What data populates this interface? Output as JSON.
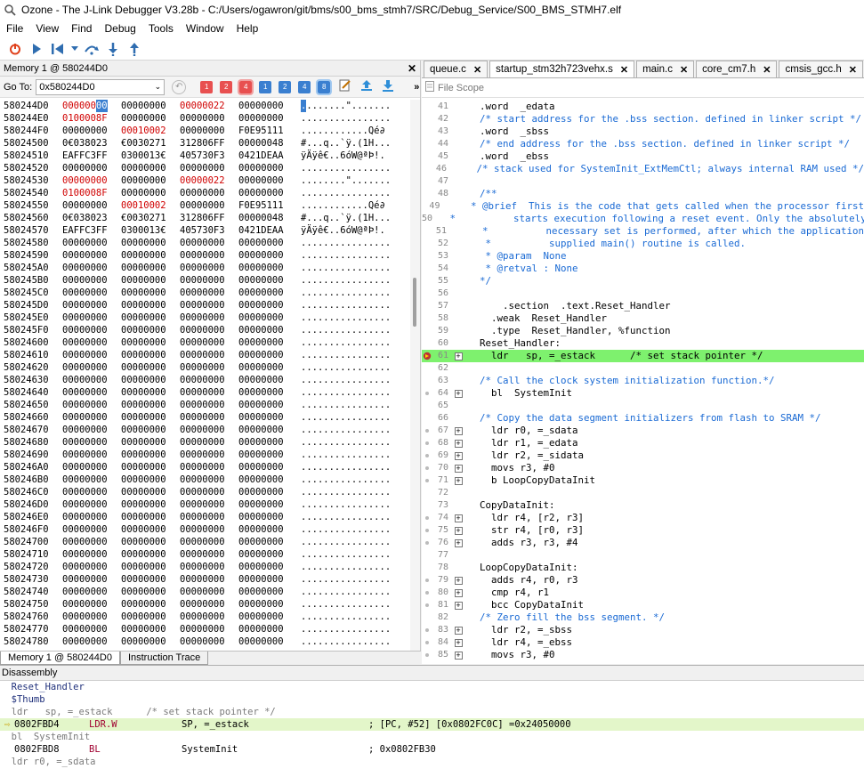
{
  "window": {
    "title": "Ozone - The J-Link Debugger V3.28b - C:/Users/ogawron/git/bms/s00_bms_stmh7/SRC/Debug_Service/S00_BMS_STMH7.elf"
  },
  "menu": [
    "File",
    "View",
    "Find",
    "Debug",
    "Tools",
    "Window",
    "Help"
  ],
  "toolbar_icons": [
    "power-icon",
    "play-icon",
    "reset-icon",
    "dropdown-icon",
    "step-over-icon",
    "step-into-icon",
    "step-out-icon"
  ],
  "memory": {
    "title": "Memory 1 @ 580244D0",
    "goto_label": "Go To:",
    "goto_value": "0x580244D0",
    "buttons": [
      "1",
      "2",
      "4",
      "1",
      "2",
      "4",
      "8"
    ],
    "rows": [
      {
        "addr": "580244D0",
        "w": [
          "00000000",
          "00000000",
          "00000022",
          "00000000"
        ],
        "red": [
          0,
          2
        ],
        "ascii": "........\"......."
      },
      {
        "addr": "580244E0",
        "w": [
          "0100008F",
          "00000000",
          "00000000",
          "00000000"
        ],
        "red": [
          0
        ],
        "ascii": "................"
      },
      {
        "addr": "580244F0",
        "w": [
          "00000000",
          "00010002",
          "00000000",
          "F0E95111"
        ],
        "red": [
          1
        ],
        "ascii": "............Qé∂"
      },
      {
        "addr": "58024500",
        "w": [
          "0€038023",
          "€0030271",
          "312806FF",
          "00000048"
        ],
        "red": [],
        "ascii": "#...q..`ÿ.(1H..."
      },
      {
        "addr": "58024510",
        "w": [
          "EAFFC3FF",
          "0300013€",
          "405730F3",
          "0421DEAA"
        ],
        "red": [],
        "ascii": "ÿÄÿê€..6óW@ªÞ!."
      },
      {
        "addr": "58024520",
        "w": [
          "00000000",
          "00000000",
          "00000000",
          "00000000"
        ],
        "red": [],
        "ascii": "................"
      },
      {
        "addr": "58024530",
        "w": [
          "00000000",
          "00000000",
          "00000022",
          "00000000"
        ],
        "red": [
          0,
          2
        ],
        "ascii": "........\"......."
      },
      {
        "addr": "58024540",
        "w": [
          "0100008F",
          "00000000",
          "00000000",
          "00000000"
        ],
        "red": [
          0
        ],
        "ascii": "................"
      },
      {
        "addr": "58024550",
        "w": [
          "00000000",
          "00010002",
          "00000000",
          "F0E95111"
        ],
        "red": [
          1
        ],
        "ascii": "............Qé∂"
      },
      {
        "addr": "58024560",
        "w": [
          "0€038023",
          "€0030271",
          "312806FF",
          "00000048"
        ],
        "red": [],
        "ascii": "#...q..`ÿ.(1H..."
      },
      {
        "addr": "58024570",
        "w": [
          "EAFFC3FF",
          "0300013€",
          "405730F3",
          "0421DEAA"
        ],
        "red": [],
        "ascii": "ÿÄÿê€..6óW@ªÞ!."
      },
      {
        "addr": "58024580",
        "w": [
          "00000000",
          "00000000",
          "00000000",
          "00000000"
        ],
        "red": [],
        "ascii": "................"
      },
      {
        "addr": "58024590",
        "w": [
          "00000000",
          "00000000",
          "00000000",
          "00000000"
        ],
        "red": [],
        "ascii": "................"
      },
      {
        "addr": "580245A0",
        "w": [
          "00000000",
          "00000000",
          "00000000",
          "00000000"
        ],
        "red": [],
        "ascii": "................"
      },
      {
        "addr": "580245B0",
        "w": [
          "00000000",
          "00000000",
          "00000000",
          "00000000"
        ],
        "red": [],
        "ascii": "................"
      },
      {
        "addr": "580245C0",
        "w": [
          "00000000",
          "00000000",
          "00000000",
          "00000000"
        ],
        "red": [],
        "ascii": "................"
      },
      {
        "addr": "580245D0",
        "w": [
          "00000000",
          "00000000",
          "00000000",
          "00000000"
        ],
        "red": [],
        "ascii": "................"
      },
      {
        "addr": "580245E0",
        "w": [
          "00000000",
          "00000000",
          "00000000",
          "00000000"
        ],
        "red": [],
        "ascii": "................"
      },
      {
        "addr": "580245F0",
        "w": [
          "00000000",
          "00000000",
          "00000000",
          "00000000"
        ],
        "red": [],
        "ascii": "................"
      },
      {
        "addr": "58024600",
        "w": [
          "00000000",
          "00000000",
          "00000000",
          "00000000"
        ],
        "red": [],
        "ascii": "................"
      },
      {
        "addr": "58024610",
        "w": [
          "00000000",
          "00000000",
          "00000000",
          "00000000"
        ],
        "red": [],
        "ascii": "................"
      },
      {
        "addr": "58024620",
        "w": [
          "00000000",
          "00000000",
          "00000000",
          "00000000"
        ],
        "red": [],
        "ascii": "................"
      },
      {
        "addr": "58024630",
        "w": [
          "00000000",
          "00000000",
          "00000000",
          "00000000"
        ],
        "red": [],
        "ascii": "................"
      },
      {
        "addr": "58024640",
        "w": [
          "00000000",
          "00000000",
          "00000000",
          "00000000"
        ],
        "red": [],
        "ascii": "................"
      },
      {
        "addr": "58024650",
        "w": [
          "00000000",
          "00000000",
          "00000000",
          "00000000"
        ],
        "red": [],
        "ascii": "................"
      },
      {
        "addr": "58024660",
        "w": [
          "00000000",
          "00000000",
          "00000000",
          "00000000"
        ],
        "red": [],
        "ascii": "................"
      },
      {
        "addr": "58024670",
        "w": [
          "00000000",
          "00000000",
          "00000000",
          "00000000"
        ],
        "red": [],
        "ascii": "................"
      },
      {
        "addr": "58024680",
        "w": [
          "00000000",
          "00000000",
          "00000000",
          "00000000"
        ],
        "red": [],
        "ascii": "................"
      },
      {
        "addr": "58024690",
        "w": [
          "00000000",
          "00000000",
          "00000000",
          "00000000"
        ],
        "red": [],
        "ascii": "................"
      },
      {
        "addr": "580246A0",
        "w": [
          "00000000",
          "00000000",
          "00000000",
          "00000000"
        ],
        "red": [],
        "ascii": "................"
      },
      {
        "addr": "580246B0",
        "w": [
          "00000000",
          "00000000",
          "00000000",
          "00000000"
        ],
        "red": [],
        "ascii": "................"
      },
      {
        "addr": "580246C0",
        "w": [
          "00000000",
          "00000000",
          "00000000",
          "00000000"
        ],
        "red": [],
        "ascii": "................"
      },
      {
        "addr": "580246D0",
        "w": [
          "00000000",
          "00000000",
          "00000000",
          "00000000"
        ],
        "red": [],
        "ascii": "................"
      },
      {
        "addr": "580246E0",
        "w": [
          "00000000",
          "00000000",
          "00000000",
          "00000000"
        ],
        "red": [],
        "ascii": "................"
      },
      {
        "addr": "580246F0",
        "w": [
          "00000000",
          "00000000",
          "00000000",
          "00000000"
        ],
        "red": [],
        "ascii": "................"
      },
      {
        "addr": "58024700",
        "w": [
          "00000000",
          "00000000",
          "00000000",
          "00000000"
        ],
        "red": [],
        "ascii": "................"
      },
      {
        "addr": "58024710",
        "w": [
          "00000000",
          "00000000",
          "00000000",
          "00000000"
        ],
        "red": [],
        "ascii": "................"
      },
      {
        "addr": "58024720",
        "w": [
          "00000000",
          "00000000",
          "00000000",
          "00000000"
        ],
        "red": [],
        "ascii": "................"
      },
      {
        "addr": "58024730",
        "w": [
          "00000000",
          "00000000",
          "00000000",
          "00000000"
        ],
        "red": [],
        "ascii": "................"
      },
      {
        "addr": "58024740",
        "w": [
          "00000000",
          "00000000",
          "00000000",
          "00000000"
        ],
        "red": [],
        "ascii": "................"
      },
      {
        "addr": "58024750",
        "w": [
          "00000000",
          "00000000",
          "00000000",
          "00000000"
        ],
        "red": [],
        "ascii": "................"
      },
      {
        "addr": "58024760",
        "w": [
          "00000000",
          "00000000",
          "00000000",
          "00000000"
        ],
        "red": [],
        "ascii": "................"
      },
      {
        "addr": "58024770",
        "w": [
          "00000000",
          "00000000",
          "00000000",
          "00000000"
        ],
        "red": [],
        "ascii": "................"
      },
      {
        "addr": "58024780",
        "w": [
          "00000000",
          "00000000",
          "00000000",
          "00000000"
        ],
        "red": [],
        "ascii": "................"
      }
    ],
    "tabs": [
      "Memory 1 @ 580244D0",
      "Instruction Trace"
    ]
  },
  "source": {
    "tabs": [
      "queue.c",
      "startup_stm32h723vehx.s",
      "main.c",
      "core_cm7.h",
      "cmsis_gcc.h"
    ],
    "active_tab": 1,
    "scope_placeholder": "File Scope",
    "lines": [
      {
        "n": "41",
        "code": "  .word  _edata",
        "bp": false,
        "exp": false
      },
      {
        "n": "42",
        "code": "  /* start address for the .bss section. defined in linker script */",
        "bp": false,
        "exp": false,
        "c": true
      },
      {
        "n": "43",
        "code": "  .word  _sbss",
        "bp": false,
        "exp": false
      },
      {
        "n": "44",
        "code": "  /* end address for the .bss section. defined in linker script */",
        "bp": false,
        "exp": false,
        "c": true
      },
      {
        "n": "45",
        "code": "  .word  _ebss",
        "bp": false,
        "exp": false
      },
      {
        "n": "46",
        "code": "  /* stack used for SystemInit_ExtMemCtl; always internal RAM used */",
        "bp": false,
        "exp": false,
        "c": true
      },
      {
        "n": "47",
        "code": "",
        "bp": false,
        "exp": false
      },
      {
        "n": "48",
        "code": "  /**",
        "bp": false,
        "exp": false,
        "c": true
      },
      {
        "n": "49",
        "code": "   * @brief  This is the code that gets called when the processor first",
        "bp": false,
        "exp": false,
        "c": true
      },
      {
        "n": "50",
        "code": "   *          starts execution following a reset event. Only the absolutely",
        "bp": false,
        "exp": false,
        "c": true
      },
      {
        "n": "51",
        "code": "   *          necessary set is performed, after which the application",
        "bp": false,
        "exp": false,
        "c": true
      },
      {
        "n": "52",
        "code": "   *          supplied main() routine is called.",
        "bp": false,
        "exp": false,
        "c": true
      },
      {
        "n": "53",
        "code": "   * @param  None",
        "bp": false,
        "exp": false,
        "c": true
      },
      {
        "n": "54",
        "code": "   * @retval : None",
        "bp": false,
        "exp": false,
        "c": true
      },
      {
        "n": "55",
        "code": "  */",
        "bp": false,
        "exp": false,
        "c": true
      },
      {
        "n": "56",
        "code": "",
        "bp": false,
        "exp": false
      },
      {
        "n": "57",
        "code": "      .section  .text.Reset_Handler",
        "bp": false,
        "exp": false
      },
      {
        "n": "58",
        "code": "    .weak  Reset_Handler",
        "bp": false,
        "exp": false
      },
      {
        "n": "59",
        "code": "    .type  Reset_Handler, %function",
        "bp": false,
        "exp": false
      },
      {
        "n": "60",
        "code": "  Reset_Handler:",
        "bp": false,
        "exp": false
      },
      {
        "n": "61",
        "code": "    ldr   sp, =_estack      /* set stack pointer */",
        "bp": true,
        "exp": true,
        "hl": true
      },
      {
        "n": "62",
        "code": "",
        "bp": false,
        "exp": false
      },
      {
        "n": "63",
        "code": "  /* Call the clock system initialization function.*/",
        "bp": false,
        "exp": false,
        "c": true
      },
      {
        "n": "64",
        "code": "    bl  SystemInit",
        "bp": true,
        "exp": true
      },
      {
        "n": "65",
        "code": "",
        "bp": false,
        "exp": false
      },
      {
        "n": "66",
        "code": "  /* Copy the data segment initializers from flash to SRAM */",
        "bp": false,
        "exp": false,
        "c": true
      },
      {
        "n": "67",
        "code": "    ldr r0, =_sdata",
        "bp": true,
        "exp": true
      },
      {
        "n": "68",
        "code": "    ldr r1, =_edata",
        "bp": true,
        "exp": true
      },
      {
        "n": "69",
        "code": "    ldr r2, =_sidata",
        "bp": true,
        "exp": true
      },
      {
        "n": "70",
        "code": "    movs r3, #0",
        "bp": true,
        "exp": true
      },
      {
        "n": "71",
        "code": "    b LoopCopyDataInit",
        "bp": true,
        "exp": true
      },
      {
        "n": "72",
        "code": "",
        "bp": false,
        "exp": false
      },
      {
        "n": "73",
        "code": "  CopyDataInit:",
        "bp": false,
        "exp": false
      },
      {
        "n": "74",
        "code": "    ldr r4, [r2, r3]",
        "bp": true,
        "exp": true
      },
      {
        "n": "75",
        "code": "    str r4, [r0, r3]",
        "bp": true,
        "exp": true
      },
      {
        "n": "76",
        "code": "    adds r3, r3, #4",
        "bp": true,
        "exp": true
      },
      {
        "n": "77",
        "code": "",
        "bp": false,
        "exp": false
      },
      {
        "n": "78",
        "code": "  LoopCopyDataInit:",
        "bp": false,
        "exp": false
      },
      {
        "n": "79",
        "code": "    adds r4, r0, r3",
        "bp": true,
        "exp": true
      },
      {
        "n": "80",
        "code": "    cmp r4, r1",
        "bp": true,
        "exp": true
      },
      {
        "n": "81",
        "code": "    bcc CopyDataInit",
        "bp": true,
        "exp": true
      },
      {
        "n": "82",
        "code": "  /* Zero fill the bss segment. */",
        "bp": false,
        "exp": false,
        "c": true
      },
      {
        "n": "83",
        "code": "    ldr r2, =_sbss",
        "bp": true,
        "exp": true
      },
      {
        "n": "84",
        "code": "    ldr r4, =_ebss",
        "bp": true,
        "exp": true
      },
      {
        "n": "85",
        "code": "    movs r3, #0",
        "bp": true,
        "exp": true
      }
    ]
  },
  "disassembly": {
    "title": "Disassembly",
    "lines": [
      {
        "type": "lbl",
        "text": "  Reset_Handler"
      },
      {
        "type": "lbl",
        "text": "  $Thumb"
      },
      {
        "type": "src",
        "text": "  ldr   sp, =_estack      /* set stack pointer */"
      },
      {
        "type": "ins",
        "hl": true,
        "addr": "0802FBD4",
        "mn": "LDR.W",
        "ops": "SP, =_estack",
        "cm": "; [PC, #52] [0x0802FC0C] =0x24050000"
      },
      {
        "type": "src",
        "text": "  bl  SystemInit"
      },
      {
        "type": "ins",
        "hl": false,
        "addr": "0802FBD8",
        "mn": "BL",
        "ops": "SystemInit",
        "cm": "; 0x0802FB30"
      },
      {
        "type": "src",
        "text": "  ldr r0, =_sdata"
      }
    ]
  },
  "colors": {
    "highlight": "#7ef16e",
    "dis_highlight": "#e3f6c9",
    "mem_red": "#d00000",
    "comment": "#1a6ad4"
  }
}
